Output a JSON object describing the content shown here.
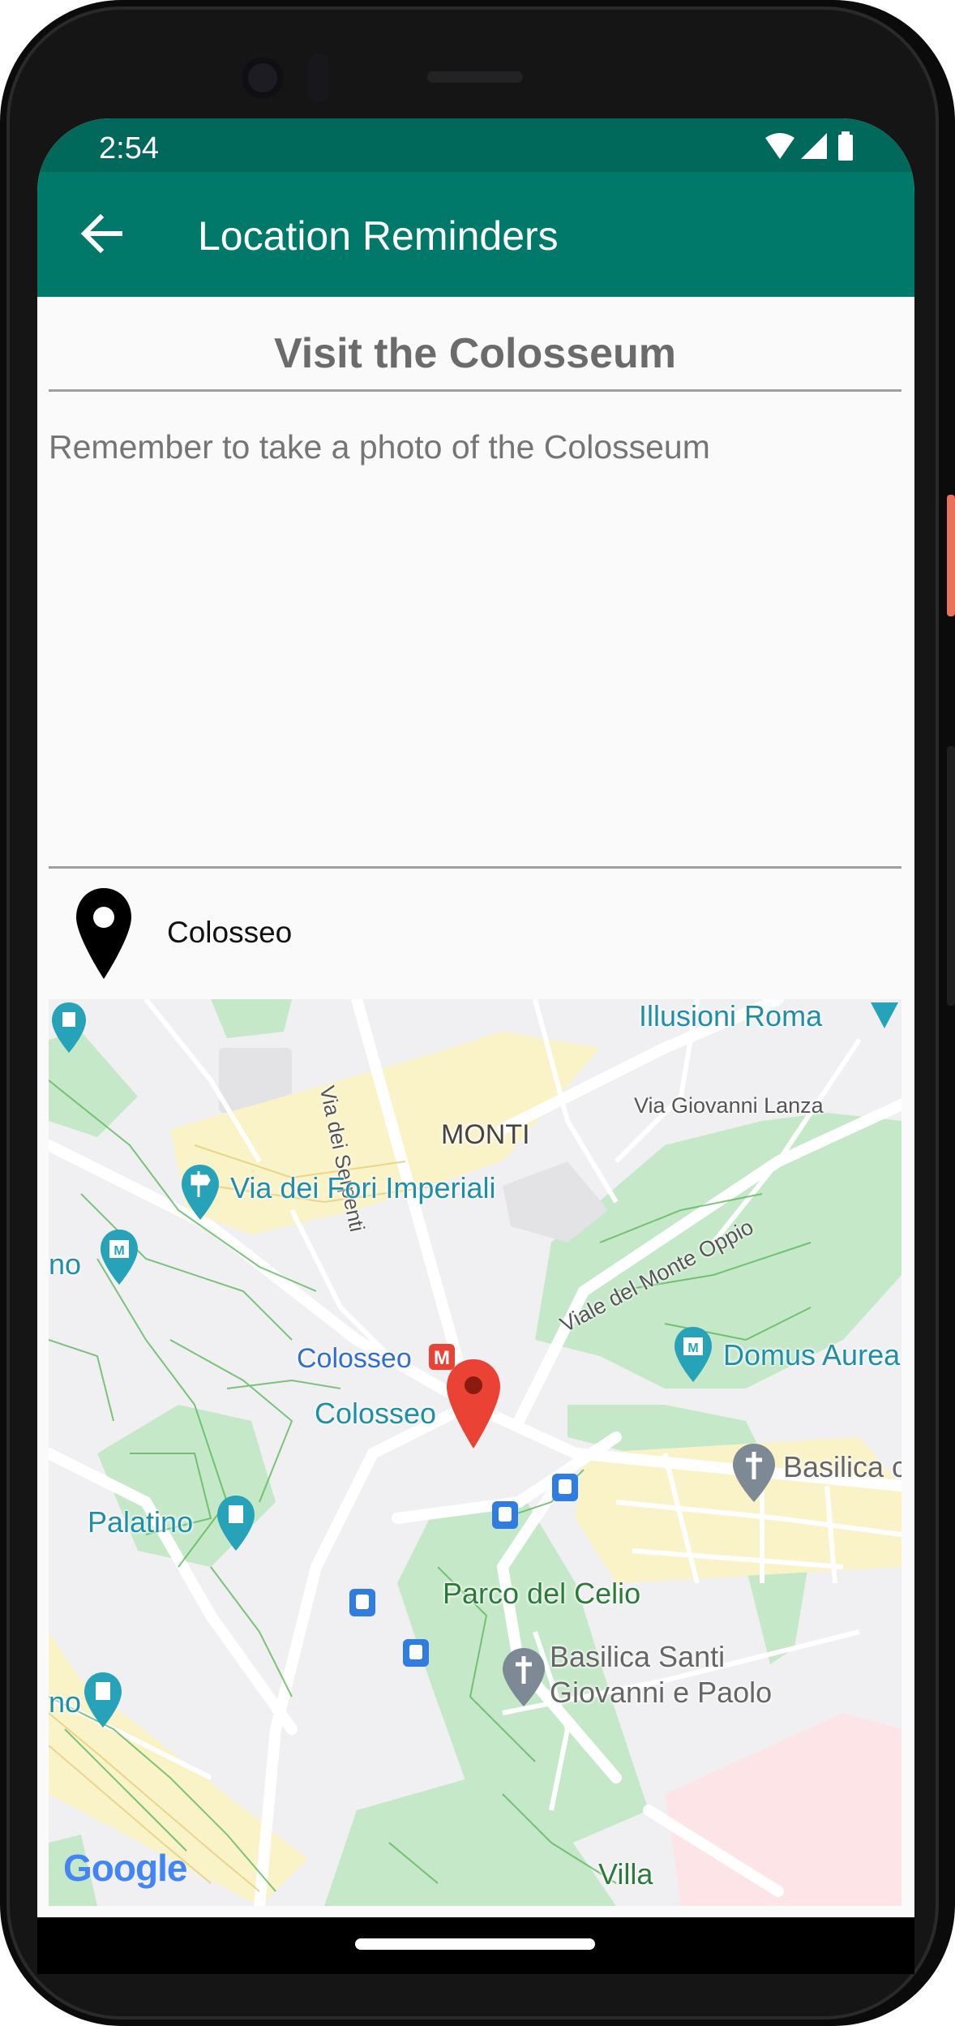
{
  "status_bar": {
    "time": "2:54"
  },
  "app_bar": {
    "title": "Location Reminders"
  },
  "reminder": {
    "title": "Visit the Colosseum",
    "description": "Remember to take a photo of the Colosseum",
    "location": "Colosseo"
  },
  "map": {
    "labels": {
      "illusioni": "Illusioni Roma",
      "serpenti": "Via dei Serpenti",
      "giovanni_lanza": "Via Giovanni Lanza",
      "monti": "MONTI",
      "fori": "Via dei Fori Imperiali",
      "monte_oppio": "Viale del Monte Oppio",
      "no1": "no",
      "colosseo_metro": "Colosseo",
      "domus": "Domus Aurea",
      "colosseo": "Colosseo",
      "basilica_c": "Basilica c",
      "palatino": "Palatino",
      "celio": "Parco del Celio",
      "basilica_santi_1": "Basilica Santi",
      "basilica_santi_2": "Giovanni e Paolo",
      "no2": "no",
      "villa": "Villa"
    },
    "attribution": "Google"
  },
  "colors": {
    "status_bar": "#00695c",
    "app_bar": "#00796b",
    "park": "#c5e8c8",
    "road_yellow": "#fbf3c8",
    "marker": "#ea4335",
    "poi_teal": "#26a3b8"
  }
}
